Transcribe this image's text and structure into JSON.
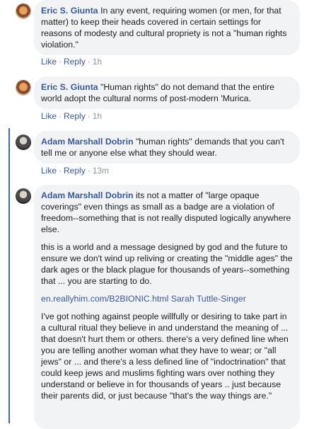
{
  "comments": [
    {
      "author": "Eric S. Giunta",
      "text": "In any event, requiring women (or men, for that matter) to keep their heads covered in certain settings for reasons of modesty and cultural propriety is not a \"human rights violation.\"",
      "like": "Like",
      "reply": "Reply",
      "time": "1h"
    },
    {
      "author": "Eric S. Giunta",
      "text": "\"Human rights\" do not demand that the entire world adopt the cultural norms of post-modern 'Murica.",
      "like": "Like",
      "reply": "Reply",
      "time": "1h"
    },
    {
      "author": "Adam Marshall Dobrin",
      "text": "\"human rights\" demands that you can't tell me or anyone else what they should wear.",
      "like": "Like",
      "reply": "Reply",
      "time": "13m"
    },
    {
      "author": "Adam Marshall Dobrin",
      "text": "its not a matter of \"large opaque coverings\" even things as small as a badge are a violation of freedom--something that is not really disputed logically anywhere else.",
      "paragraph2": "this is a world and a message designed by god and the future to ensure we don't wind up reliving or creating the \"middle ages\" the dark ages or the black plague for thousands of years--something that ... you are starting to do.",
      "link_url": "en.reallyhim.com/B2BIONIC.html",
      "link_name": "Sarah Tuttle-Singer",
      "paragraph4": "I've got nothing against people willfully or desiring to take part in a cultural ritual they believe in and understand the meaning of ... that doesn't hurt them or others. there's a very defined line when you are telling another woman what they have to wear; or \"all jews\" or ... and there's a less defined line of \"indoctrination\" that could keep jews and muslims fighting wars over nothing they understand or believe in for thousands of years .. just because their parents did, or just because \"that's the way things are.\""
    }
  ],
  "separator": "·",
  "colors": {
    "link": "#385898",
    "bubble": "#f2f3f5",
    "thread": "#4267b2"
  }
}
